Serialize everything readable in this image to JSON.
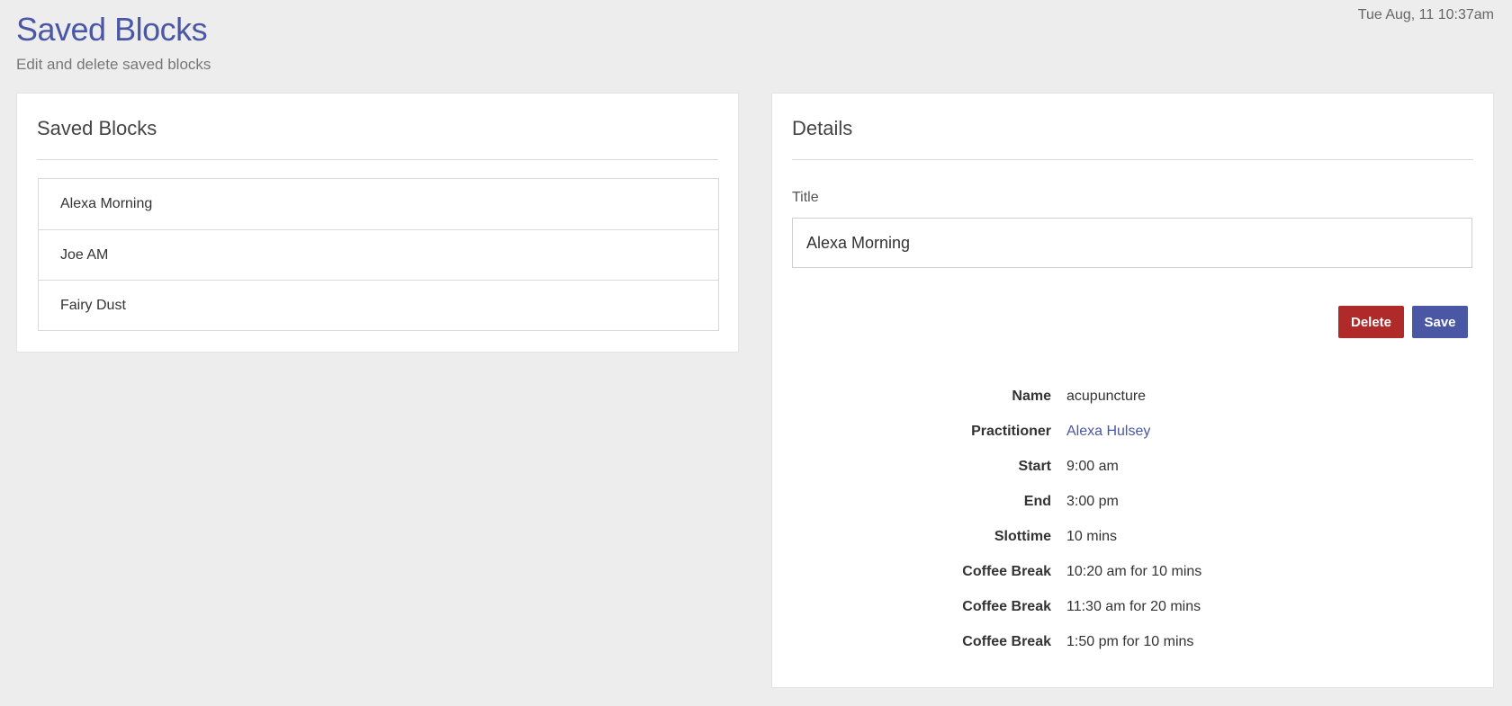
{
  "header": {
    "timestamp": "Tue Aug, 11 10:37am",
    "title": "Saved Blocks",
    "subtitle": "Edit and delete saved blocks"
  },
  "saved_blocks": {
    "heading": "Saved Blocks",
    "items": [
      {
        "label": "Alexa Morning"
      },
      {
        "label": "Joe AM"
      },
      {
        "label": "Fairy Dust"
      }
    ]
  },
  "details": {
    "heading": "Details",
    "title_label": "Title",
    "title_value": "Alexa Morning",
    "delete_label": "Delete",
    "save_label": "Save",
    "rows": [
      {
        "label": "Name",
        "value": "acupuncture"
      },
      {
        "label": "Practitioner",
        "value": "Alexa Hulsey"
      },
      {
        "label": "Start",
        "value": "9:00 am"
      },
      {
        "label": "End",
        "value": "3:00 pm"
      },
      {
        "label": "Slottime",
        "value": "10 mins"
      },
      {
        "label": "Coffee Break",
        "value": "10:20 am for 10 mins"
      },
      {
        "label": "Coffee Break",
        "value": "11:30 am for 20 mins"
      },
      {
        "label": "Coffee Break",
        "value": "1:50 pm for 10 mins"
      }
    ]
  },
  "colors": {
    "accent": "#4a57a5",
    "danger": "#b02a2a",
    "background": "#ededed"
  }
}
